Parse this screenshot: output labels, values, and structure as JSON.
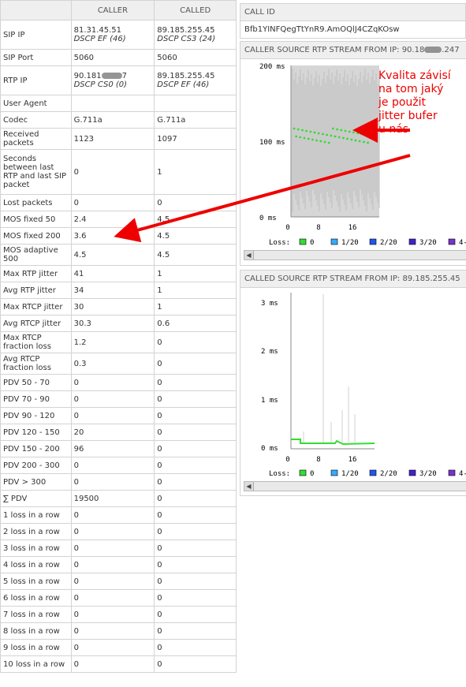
{
  "header": {
    "caller": "CALLER",
    "called": "CALLED"
  },
  "rows": [
    {
      "label": "SIP IP",
      "caller": "81.31.45.51",
      "caller_sub": "DSCP EF (46)",
      "called": "89.185.255.45",
      "called_sub": "DSCP CS3 (24)"
    },
    {
      "label": "SIP Port",
      "caller": "5060",
      "called": "5060"
    },
    {
      "label": "RTP IP",
      "caller_pre": "90.181",
      "caller_post": "7",
      "caller_sub": "DSCP CS0 (0)",
      "called": "89.185.255.45",
      "called_sub": "DSCP EF (46)"
    },
    {
      "label": "User Agent",
      "caller": "",
      "called": ""
    },
    {
      "label": "Codec",
      "caller": "G.711a",
      "called": "G.711a"
    },
    {
      "label": "Received packets",
      "caller": "1123",
      "called": "1097"
    },
    {
      "label": "Seconds between last RTP and last SIP packet",
      "caller": "0",
      "called": "1"
    },
    {
      "label": "Lost packets",
      "caller": "0",
      "called": "0"
    },
    {
      "label": "MOS fixed 50",
      "caller": "2.4",
      "called": "4.5"
    },
    {
      "label": "MOS fixed 200",
      "caller": "3.6",
      "called": "4.5"
    },
    {
      "label": "MOS adaptive 500",
      "caller": "4.5",
      "called": "4.5"
    },
    {
      "label": "Max RTP jitter",
      "caller": "41",
      "called": "1"
    },
    {
      "label": "Avg RTP jitter",
      "caller": "34",
      "called": "1"
    },
    {
      "label": "Max RTCP jitter",
      "caller": "30",
      "called": "1"
    },
    {
      "label": "Avg RTCP jitter",
      "caller": "30.3",
      "called": "0.6"
    },
    {
      "label": "Max RTCP fraction loss",
      "caller": "1.2",
      "called": "0"
    },
    {
      "label": "Avg RTCP fraction loss",
      "caller": "0.3",
      "called": "0"
    },
    {
      "label": "PDV 50 - 70",
      "caller": "0",
      "called": "0"
    },
    {
      "label": "PDV 70 - 90",
      "caller": "0",
      "called": "0"
    },
    {
      "label": "PDV 90 - 120",
      "caller": "0",
      "called": "0"
    },
    {
      "label": "PDV 120 - 150",
      "caller": "20",
      "called": "0"
    },
    {
      "label": "PDV 150 - 200",
      "caller": "96",
      "called": "0"
    },
    {
      "label": "PDV 200 - 300",
      "caller": "0",
      "called": "0"
    },
    {
      "label": "PDV > 300",
      "caller": "0",
      "called": "0"
    },
    {
      "label": "∑ PDV",
      "caller": "19500",
      "called": "0"
    },
    {
      "label": "1 loss in a row",
      "caller": "0",
      "called": "0"
    },
    {
      "label": "2 loss in a row",
      "caller": "0",
      "called": "0"
    },
    {
      "label": "3 loss in a row",
      "caller": "0",
      "called": "0"
    },
    {
      "label": "4 loss in a row",
      "caller": "0",
      "called": "0"
    },
    {
      "label": "5 loss in a row",
      "caller": "0",
      "called": "0"
    },
    {
      "label": "6 loss in a row",
      "caller": "0",
      "called": "0"
    },
    {
      "label": "7 loss in a row",
      "caller": "0",
      "called": "0"
    },
    {
      "label": "8 loss in a row",
      "caller": "0",
      "called": "0"
    },
    {
      "label": "9 loss in a row",
      "caller": "0",
      "called": "0"
    },
    {
      "label": "10 loss in a row",
      "caller": "0",
      "called": "0"
    }
  ],
  "call_id": {
    "title": "CALL ID",
    "value": "Bfb1YINFQegTtYnR9.AmOQlJ4CZqKOsw"
  },
  "caller_stream": {
    "title_pre": "CALLER SOURCE RTP STREAM FROM IP: 90.18",
    "title_post": ".247",
    "y_ticks": [
      "200 ms",
      "100 ms",
      "0 ms"
    ],
    "x_ticks": [
      "0",
      "8",
      "16"
    ],
    "loss_label": "Loss:",
    "legend": [
      "0",
      "1/20",
      "2/20",
      "3/20",
      "4-"
    ]
  },
  "called_stream": {
    "title": "CALLED SOURCE RTP STREAM FROM IP: 89.185.255.45",
    "y_ticks": [
      "3 ms",
      "2 ms",
      "1 ms",
      "0 ms"
    ],
    "x_ticks": [
      "0",
      "8",
      "16"
    ],
    "loss_label": "Loss:",
    "legend": [
      "0",
      "1/20",
      "2/20",
      "3/20",
      "4-"
    ]
  },
  "legend_colors": [
    "#33dd33",
    "#33aaff",
    "#2255ee",
    "#4422cc",
    "#7733cc"
  ],
  "annotation": {
    "text": "Kvalita závisí\nna tom jaký\nje použit\njitter bufer\nu nás",
    "color": "#e00000"
  }
}
